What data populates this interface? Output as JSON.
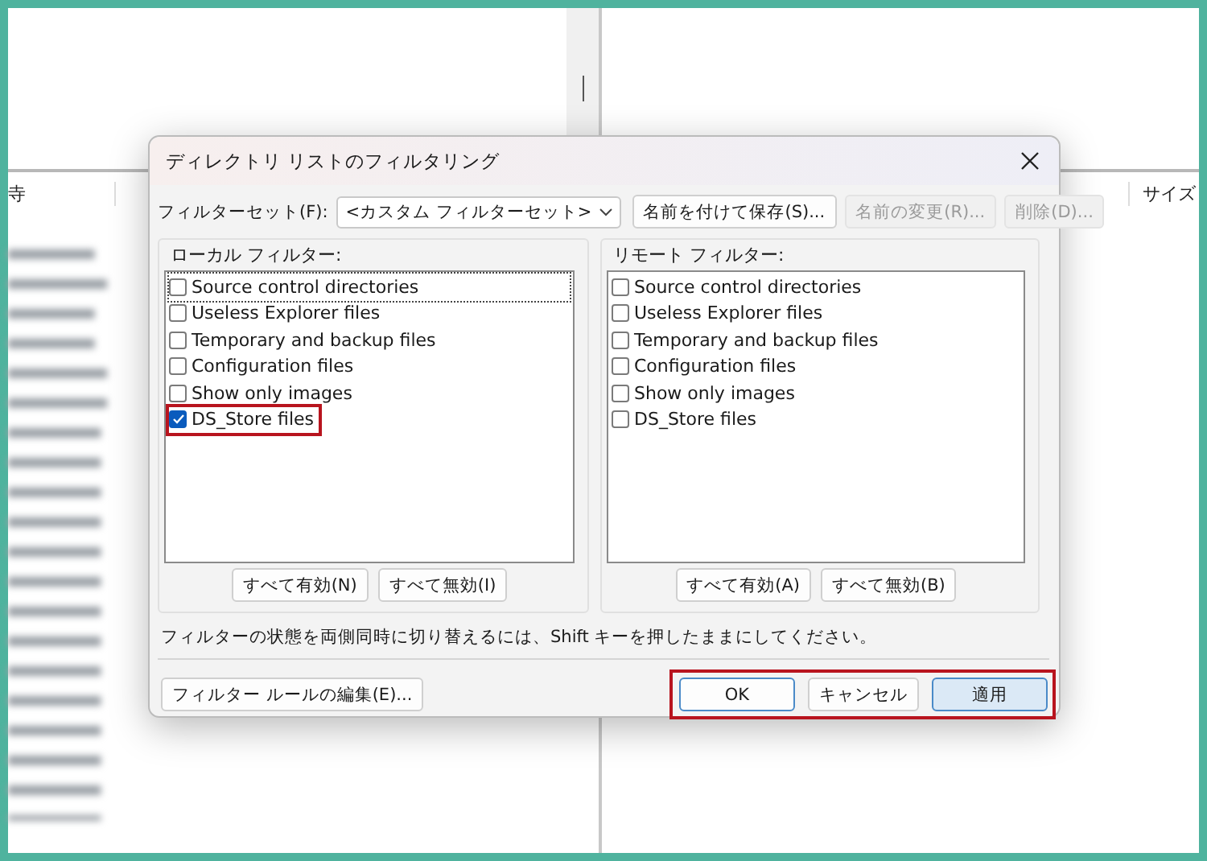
{
  "background": {
    "left_header": "寺",
    "right_header": "サイズ"
  },
  "dialog": {
    "title": "ディレクトリ リストのフィルタリング",
    "filter_set": {
      "label": "フィルターセット(F):",
      "value": "<カスタム フィルターセット>"
    },
    "top_buttons": [
      {
        "label": "名前を付けて保存(S)...",
        "disabled": false
      },
      {
        "label": "名前の変更(R)...",
        "disabled": true
      },
      {
        "label": "削除(D)...",
        "disabled": true
      }
    ],
    "groups": [
      {
        "title": "ローカル フィルター:",
        "items": [
          {
            "label": "Source control directories",
            "checked": false,
            "highlighted": false,
            "focused": true
          },
          {
            "label": "Useless Explorer files",
            "checked": false,
            "highlighted": false,
            "focused": false
          },
          {
            "label": "Temporary and backup files",
            "checked": false,
            "highlighted": false,
            "focused": false
          },
          {
            "label": "Configuration files",
            "checked": false,
            "highlighted": false,
            "focused": false
          },
          {
            "label": "Show only images",
            "checked": false,
            "highlighted": false,
            "focused": false
          },
          {
            "label": "DS_Store files",
            "checked": true,
            "highlighted": true,
            "focused": false
          }
        ],
        "buttons": [
          "すべて有効(N)",
          "すべて無効(I)"
        ]
      },
      {
        "title": "リモート フィルター:",
        "items": [
          {
            "label": "Source control directories",
            "checked": false,
            "highlighted": false,
            "focused": false
          },
          {
            "label": "Useless Explorer files",
            "checked": false,
            "highlighted": false,
            "focused": false
          },
          {
            "label": "Temporary and backup files",
            "checked": false,
            "highlighted": false,
            "focused": false
          },
          {
            "label": "Configuration files",
            "checked": false,
            "highlighted": false,
            "focused": false
          },
          {
            "label": "Show only images",
            "checked": false,
            "highlighted": false,
            "focused": false
          },
          {
            "label": "DS_Store files",
            "checked": false,
            "highlighted": false,
            "focused": false
          }
        ],
        "buttons": [
          "すべて有効(A)",
          "すべて無効(B)"
        ]
      }
    ],
    "hint": "フィルターの状態を両側同時に切り替えるには、Shift キーを押したままにしてください。",
    "edit_rules_button": "フィルター ルールの編集(E)...",
    "footer_buttons": [
      {
        "label": "OK",
        "kind": "default"
      },
      {
        "label": "キャンセル",
        "kind": "normal"
      },
      {
        "label": "適用",
        "kind": "accent"
      }
    ],
    "footer_highlighted": true
  }
}
